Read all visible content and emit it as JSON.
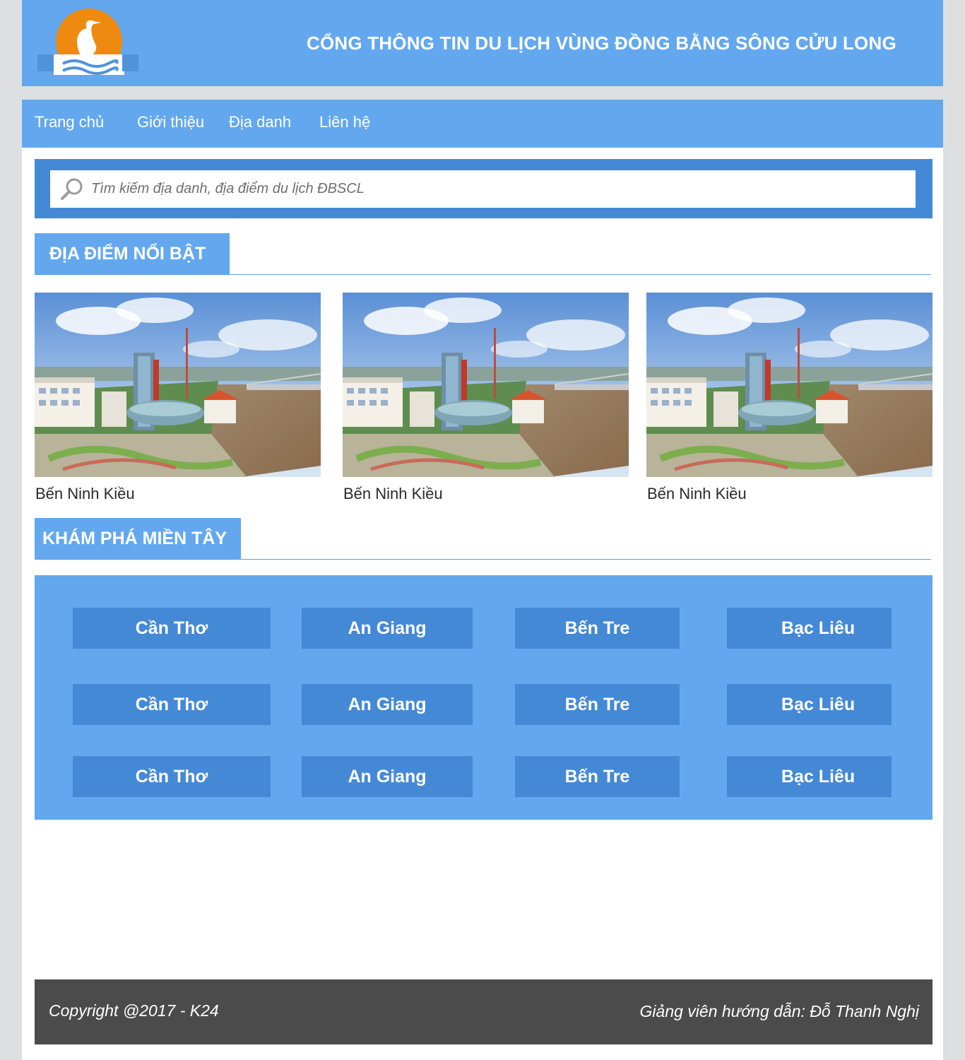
{
  "header": {
    "site_title": "CỔNG THÔNG TIN DU LỊCH VÙNG ĐỒNG BẰNG SÔNG CỬU LONG",
    "logo_icon": "heron-sun-waves-logo",
    "colors": {
      "header_bg": "#63a8ee",
      "accent": "#4489d6",
      "logo_orange": "#f08a12"
    }
  },
  "nav": {
    "items": [
      {
        "label": "Trang chủ"
      },
      {
        "label": "Giới thiệu"
      },
      {
        "label": "Địa danh"
      },
      {
        "label": "Liên hệ"
      }
    ]
  },
  "search": {
    "placeholder": "Tìm kiếm địa danh, địa điểm du lịch ĐBSCL",
    "value": "",
    "icon": "search-icon"
  },
  "featured": {
    "heading": "ĐỊA ĐIỂM NỔI BẬT",
    "cards": [
      {
        "label": "Bến Ninh Kiều",
        "image": "city-riverside-aerial"
      },
      {
        "label": "Bến Ninh Kiều",
        "image": "city-riverside-aerial"
      },
      {
        "label": "Bến Ninh Kiều",
        "image": "city-riverside-aerial"
      }
    ]
  },
  "explore": {
    "heading": "KHÁM PHÁ MIỀN TÂY",
    "rows": [
      [
        "Cần Thơ",
        "An Giang",
        "Bến Tre",
        "Bạc Liêu"
      ],
      [
        "Cần Thơ",
        "An Giang",
        "Bến Tre",
        "Bạc Liêu"
      ],
      [
        "Cần Thơ",
        "An Giang",
        "Bến Tre",
        "Bạc Liêu"
      ]
    ]
  },
  "footer": {
    "copyright": "Copyright @2017 - K24",
    "instructor": "Giảng viên hướng dẫn: Đỗ Thanh Nghị",
    "colors": {
      "footer_bg": "#4b4b4b"
    }
  }
}
